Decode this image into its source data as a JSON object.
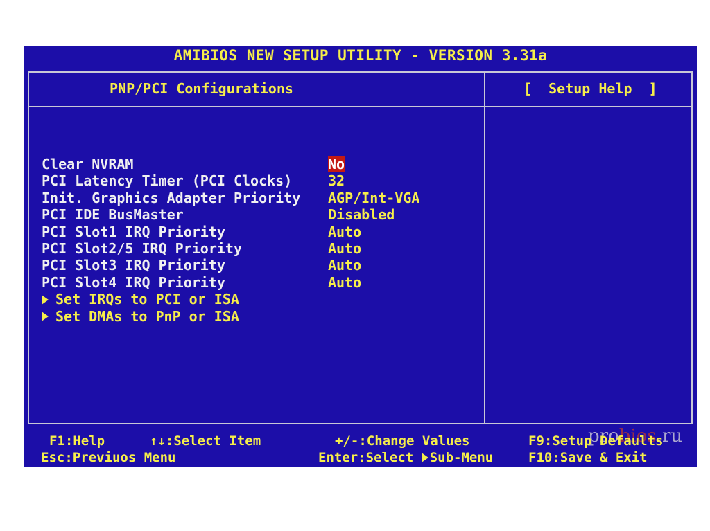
{
  "title": "AMIBIOS NEW SETUP UTILITY - VERSION 3.31a",
  "left_pane_title": "PNP/PCI Configurations",
  "help_title": "[  Setup Help  ]",
  "settings": [
    {
      "label": "Clear NVRAM",
      "value": "No",
      "selected": true
    },
    {
      "label": "PCI Latency Timer (PCI Clocks)",
      "value": "32"
    },
    {
      "label": "Init. Graphics Adapter Priority",
      "value": "AGP/Int-VGA"
    },
    {
      "label": "PCI IDE BusMaster",
      "value": "Disabled"
    },
    {
      "label": "PCI Slot1 IRQ Priority",
      "value": "Auto"
    },
    {
      "label": "PCI Slot2/5 IRQ Priority",
      "value": "Auto"
    },
    {
      "label": "PCI Slot3 IRQ Priority",
      "value": "Auto"
    },
    {
      "label": "PCI Slot4 IRQ Priority",
      "value": "Auto"
    }
  ],
  "submenus": [
    {
      "label": "Set IRQs to PCI or ISA"
    },
    {
      "label": "Set DMAs to PnP or ISA"
    }
  ],
  "footer": {
    "f1": "F1:Help",
    "select": "↑↓:Select Item",
    "change": "+/-:Change Values",
    "f9": "F9:Setup Defaults",
    "esc": "Esc:Previuos Menu",
    "enter_prefix": "Enter:Select ",
    "enter_suffix": "Sub-Menu",
    "f10": "F10:Save & Exit"
  },
  "watermark": {
    "part1": "pro",
    "part2": "bios",
    "part3": ".ru"
  },
  "colors": {
    "background": "#1c0ea8",
    "text_yellow": "#f6ee4a",
    "text_white": "#f0f0f0",
    "highlight": "#c41a14"
  }
}
